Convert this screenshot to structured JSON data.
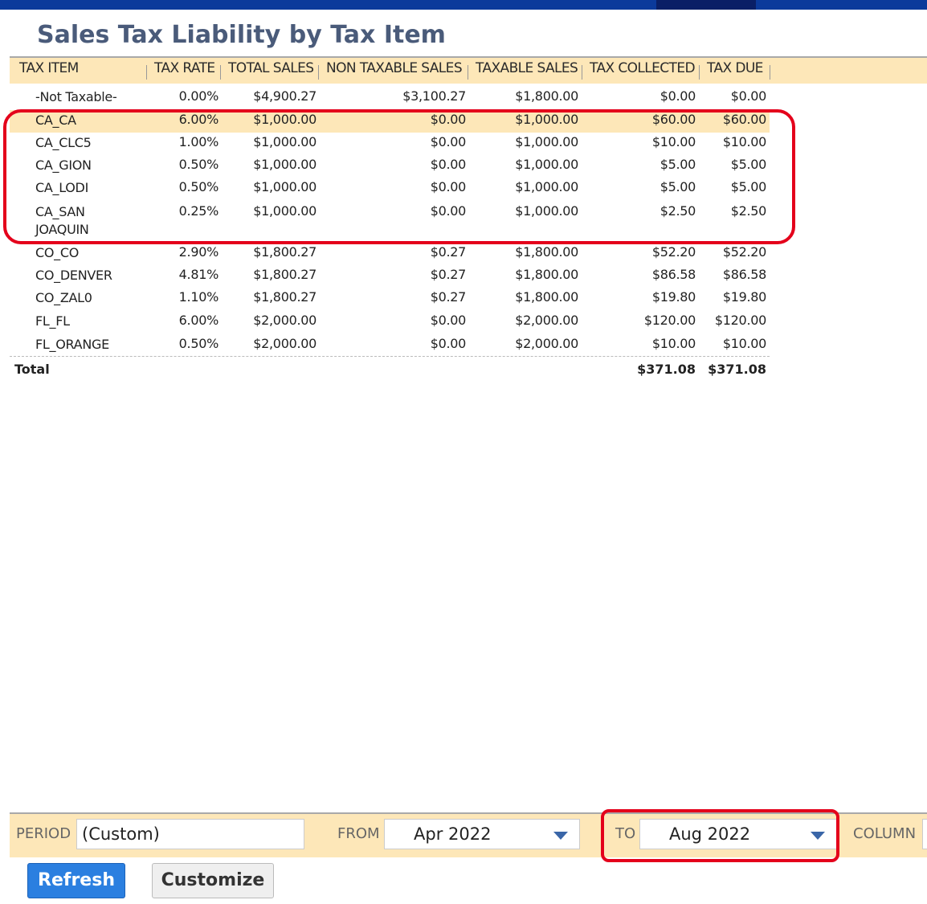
{
  "page": {
    "title": "Sales Tax Liability by Tax Item"
  },
  "report": {
    "columns": [
      "TAX ITEM",
      "TAX RATE",
      "TOTAL SALES",
      "NON TAXABLE SALES",
      "TAXABLE SALES",
      "TAX COLLECTED",
      "TAX DUE"
    ],
    "rows": [
      {
        "item": "-Not Taxable-",
        "rate": "0.00%",
        "total": "$4,900.27",
        "nontax": "$3,100.27",
        "taxable": "$1,800.00",
        "collected": "$0.00",
        "due": "$0.00"
      },
      {
        "item": "CA_CA",
        "rate": "6.00%",
        "total": "$1,000.00",
        "nontax": "$0.00",
        "taxable": "$1,000.00",
        "collected": "$60.00",
        "due": "$60.00"
      },
      {
        "item": "CA_CLC5",
        "rate": "1.00%",
        "total": "$1,000.00",
        "nontax": "$0.00",
        "taxable": "$1,000.00",
        "collected": "$10.00",
        "due": "$10.00"
      },
      {
        "item": "CA_GION",
        "rate": "0.50%",
        "total": "$1,000.00",
        "nontax": "$0.00",
        "taxable": "$1,000.00",
        "collected": "$5.00",
        "due": "$5.00"
      },
      {
        "item": "CA_LODI",
        "rate": "0.50%",
        "total": "$1,000.00",
        "nontax": "$0.00",
        "taxable": "$1,000.00",
        "collected": "$5.00",
        "due": "$5.00"
      },
      {
        "item": "CA_SAN JOAQUIN",
        "rate": "0.25%",
        "total": "$1,000.00",
        "nontax": "$0.00",
        "taxable": "$1,000.00",
        "collected": "$2.50",
        "due": "$2.50"
      },
      {
        "item": "CO_CO",
        "rate": "2.90%",
        "total": "$1,800.27",
        "nontax": "$0.27",
        "taxable": "$1,800.00",
        "collected": "$52.20",
        "due": "$52.20"
      },
      {
        "item": "CO_DENVER",
        "rate": "4.81%",
        "total": "$1,800.27",
        "nontax": "$0.27",
        "taxable": "$1,800.00",
        "collected": "$86.58",
        "due": "$86.58"
      },
      {
        "item": "CO_ZAL0",
        "rate": "1.10%",
        "total": "$1,800.27",
        "nontax": "$0.27",
        "taxable": "$1,800.00",
        "collected": "$19.80",
        "due": "$19.80"
      },
      {
        "item": "FL_FL",
        "rate": "6.00%",
        "total": "$2,000.00",
        "nontax": "$0.00",
        "taxable": "$2,000.00",
        "collected": "$120.00",
        "due": "$120.00"
      },
      {
        "item": "FL_ORANGE",
        "rate": "0.50%",
        "total": "$2,000.00",
        "nontax": "$0.00",
        "taxable": "$2,000.00",
        "collected": "$10.00",
        "due": "$10.00"
      }
    ],
    "total": {
      "label": "Total",
      "collected": "$371.08",
      "due": "$371.08"
    }
  },
  "filters": {
    "period_label": "PERIOD",
    "period_value": "(Custom)",
    "from_label": "FROM",
    "from_value": "Apr 2022",
    "to_label": "TO",
    "to_value": "Aug 2022",
    "column_label": "COLUMN"
  },
  "buttons": {
    "refresh": "Refresh",
    "customize": "Customize"
  },
  "colors": {
    "accent": "#2b7fe0",
    "header_bg": "#fde7b8",
    "annotation": "#e4001b",
    "topbar": "#0b3a9b"
  }
}
